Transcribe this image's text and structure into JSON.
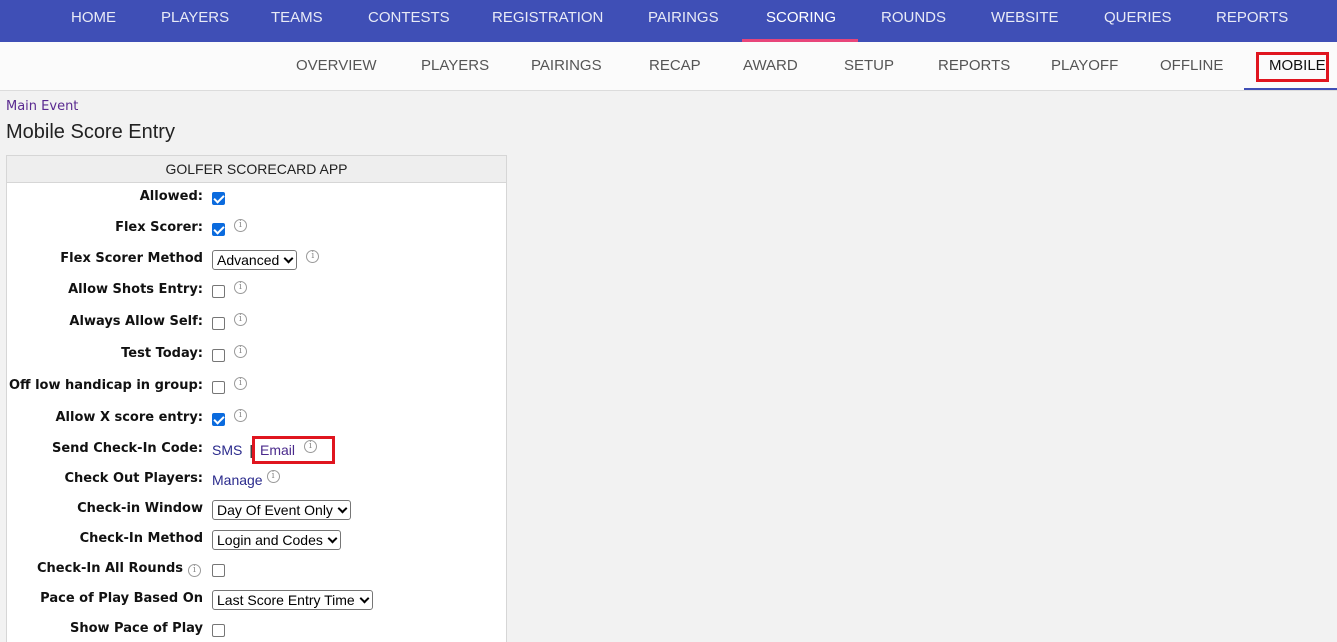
{
  "top_nav": {
    "items": [
      "HOME",
      "PLAYERS",
      "TEAMS",
      "CONTESTS",
      "REGISTRATION",
      "PAIRINGS",
      "SCORING",
      "ROUNDS",
      "WEBSITE",
      "QUERIES",
      "REPORTS"
    ],
    "active": "SCORING"
  },
  "sub_nav": {
    "items": [
      "OVERVIEW",
      "PLAYERS",
      "PAIRINGS",
      "RECAP",
      "AWARD",
      "SETUP",
      "REPORTS",
      "PLAYOFF",
      "OFFLINE",
      "MOBILE"
    ],
    "active": "MOBILE"
  },
  "breadcrumb": "Main Event",
  "page_title": "Mobile Score Entry",
  "panel": {
    "title": "GOLFER SCORECARD APP",
    "rows": {
      "allowed": {
        "label": "Allowed:",
        "checked": true
      },
      "flex_scorer": {
        "label": "Flex Scorer:",
        "checked": true
      },
      "flex_scorer_method": {
        "label": "Flex Scorer Method",
        "value": "Advanced"
      },
      "allow_shots_entry": {
        "label": "Allow Shots Entry:",
        "checked": false
      },
      "always_allow_self": {
        "label": "Always Allow Self:",
        "checked": false
      },
      "test_today": {
        "label": "Test Today:",
        "checked": false
      },
      "off_low_handicap": {
        "label": "Off low handicap in group:",
        "checked": false
      },
      "allow_x_score": {
        "label": "Allow X score entry:",
        "checked": true
      },
      "send_checkin_code": {
        "label": "Send Check-In Code:",
        "sms": "SMS",
        "separator": "|",
        "email": "Email"
      },
      "check_out_players": {
        "label": "Check Out Players:",
        "link": "Manage"
      },
      "checkin_window": {
        "label": "Check-in Window",
        "value": "Day Of Event Only"
      },
      "checkin_method": {
        "label": "Check-In Method",
        "value": "Login and Codes"
      },
      "checkin_all_rounds": {
        "label": "Check-In All Rounds",
        "checked": false
      },
      "pace_of_play": {
        "label": "Pace of Play Based On",
        "value": "Last Score Entry Time"
      },
      "show_pace_of_play": {
        "label": "Show Pace of Play",
        "checked": false
      }
    }
  },
  "info_glyph": "i",
  "colors": {
    "top_nav_bg": "#3f4fb6",
    "active_underline": "#e8457a",
    "highlight_box": "#e0151f",
    "checkbox_checked": "#0b6bde"
  }
}
